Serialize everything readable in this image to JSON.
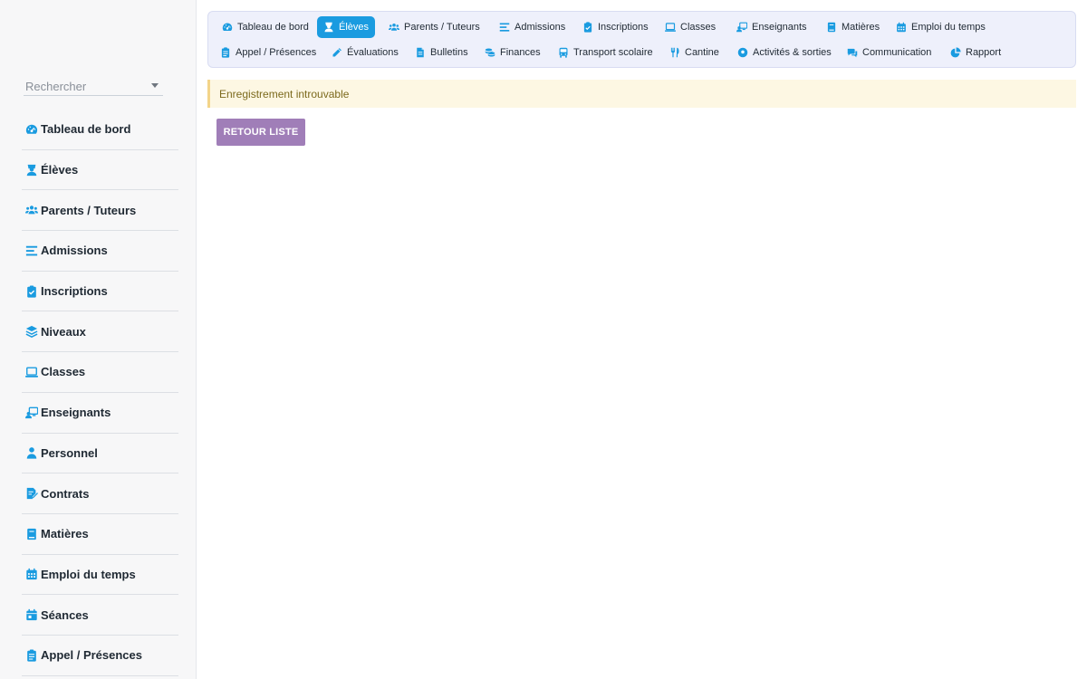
{
  "search": {
    "placeholder": "Rechercher"
  },
  "sidebar": {
    "items": [
      {
        "label": "Tableau de bord",
        "icon": "dashboard-icon"
      },
      {
        "label": "Élèves",
        "icon": "student-icon"
      },
      {
        "label": "Parents / Tuteurs",
        "icon": "users-icon"
      },
      {
        "label": "Admissions",
        "icon": "list-icon"
      },
      {
        "label": "Inscriptions",
        "icon": "clipboard-check-icon"
      },
      {
        "label": "Niveaux",
        "icon": "layers-icon"
      },
      {
        "label": "Classes",
        "icon": "laptop-icon"
      },
      {
        "label": "Enseignants",
        "icon": "teacher-icon"
      },
      {
        "label": "Personnel",
        "icon": "person-icon"
      },
      {
        "label": "Contrats",
        "icon": "contract-icon"
      },
      {
        "label": "Matières",
        "icon": "book-icon"
      },
      {
        "label": "Emploi du temps",
        "icon": "calendar-icon"
      },
      {
        "label": "Séances",
        "icon": "calendar-day-icon"
      },
      {
        "label": "Appel / Présences",
        "icon": "clipboard-list-icon"
      }
    ]
  },
  "topnav": {
    "row1": [
      {
        "label": "Tableau de bord",
        "icon": "dashboard-icon",
        "active": false
      },
      {
        "label": "Élèves",
        "icon": "student-icon",
        "active": true
      },
      {
        "label": "Parents / Tuteurs",
        "icon": "users-icon",
        "active": false
      },
      {
        "label": "Admissions",
        "icon": "list-icon",
        "active": false
      },
      {
        "label": "Inscriptions",
        "icon": "clipboard-check-icon",
        "active": false
      },
      {
        "label": "Classes",
        "icon": "laptop-icon",
        "active": false
      },
      {
        "label": "Enseignants",
        "icon": "teacher-icon",
        "active": false
      },
      {
        "label": "Matières",
        "icon": "book-icon",
        "active": false
      },
      {
        "label": "Emploi du temps",
        "icon": "calendar-icon",
        "active": false
      }
    ],
    "row2": [
      {
        "label": "Appel / Présences",
        "icon": "clipboard-list-icon",
        "active": false
      },
      {
        "label": "Évaluations",
        "icon": "pencil-icon",
        "active": false
      },
      {
        "label": "Bulletins",
        "icon": "file-icon",
        "active": false
      },
      {
        "label": "Finances",
        "icon": "coins-icon",
        "active": false
      },
      {
        "label": "Transport scolaire",
        "icon": "bus-icon",
        "active": false
      },
      {
        "label": "Cantine",
        "icon": "utensils-icon",
        "active": false
      },
      {
        "label": "Activités & sorties",
        "icon": "football-icon",
        "active": false
      },
      {
        "label": "Communication",
        "icon": "chat-icon",
        "active": false
      },
      {
        "label": "Rapport",
        "icon": "pie-chart-icon",
        "active": false
      }
    ]
  },
  "alert": {
    "message": "Enregistrement introuvable"
  },
  "actions": {
    "back_label": "RETOUR LISTE"
  },
  "colors": {
    "accent": "#1a9be0",
    "icon": "#1a9be0",
    "back_button": "#a07eb8",
    "alert_bg": "#fdf7e3",
    "alert_border": "#f3d489",
    "nav_bg": "#eef0fb"
  }
}
